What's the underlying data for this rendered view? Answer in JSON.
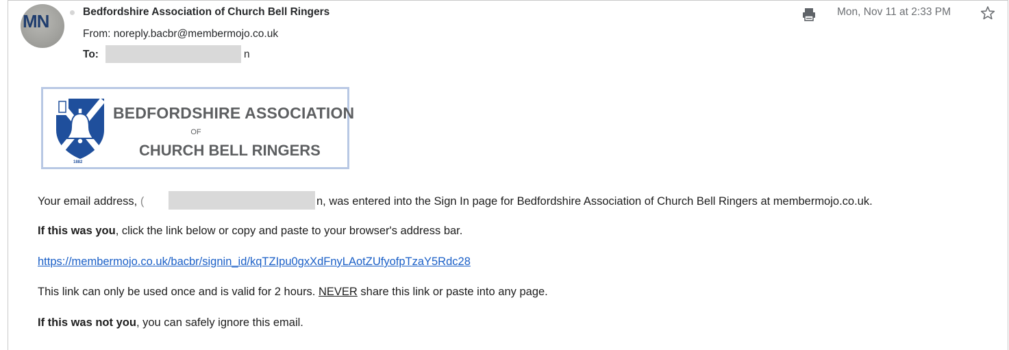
{
  "header": {
    "avatar_initials": "MN",
    "sender_name": "Bedfordshire Association of Church Bell Ringers",
    "from_label": "From:",
    "from_address": "noreply.bacbr@membermojo.co.uk",
    "to_label": "To:",
    "to_visible_tail": "n",
    "date": "Mon, Nov 11 at 2:33 PM",
    "print_icon": "print-icon",
    "star_icon": "star-icon"
  },
  "logo": {
    "line1": "BEDFORDSHIRE ASSOCIATION",
    "of": "OF",
    "line2": "CHURCH BELL RINGERS",
    "year": "1882",
    "colors": {
      "shield_blue": "#1f4f9c",
      "border": "#b8c8e4",
      "text": "#5d5f61"
    }
  },
  "body": {
    "p1_start": "Your email address, ",
    "p1_partial": "(",
    "p1_tail": "n, was entered into the Sign In page for Bedfordshire Association of Church Bell Ringers at membermojo.co.uk.",
    "p2_bold": "If this was you",
    "p2_rest": ", click the link below or copy and paste to your browser's address bar.",
    "link": "https://membermojo.co.uk/bacbr/signin_id/kqTZIpu0gxXdFnyLAotZUfyofpTzaY5Rdc28",
    "p4_start": "This link can only be used once and is valid for 2 hours. ",
    "p4_underlined": "NEVER",
    "p4_end": " share this link or paste into any page.",
    "p5_bold": "If this was not you",
    "p5_rest": ", you can safely ignore this email."
  },
  "colors": {
    "link": "#1a5fc7",
    "redaction": "#d9d9d9",
    "date": "#6b6e72"
  }
}
